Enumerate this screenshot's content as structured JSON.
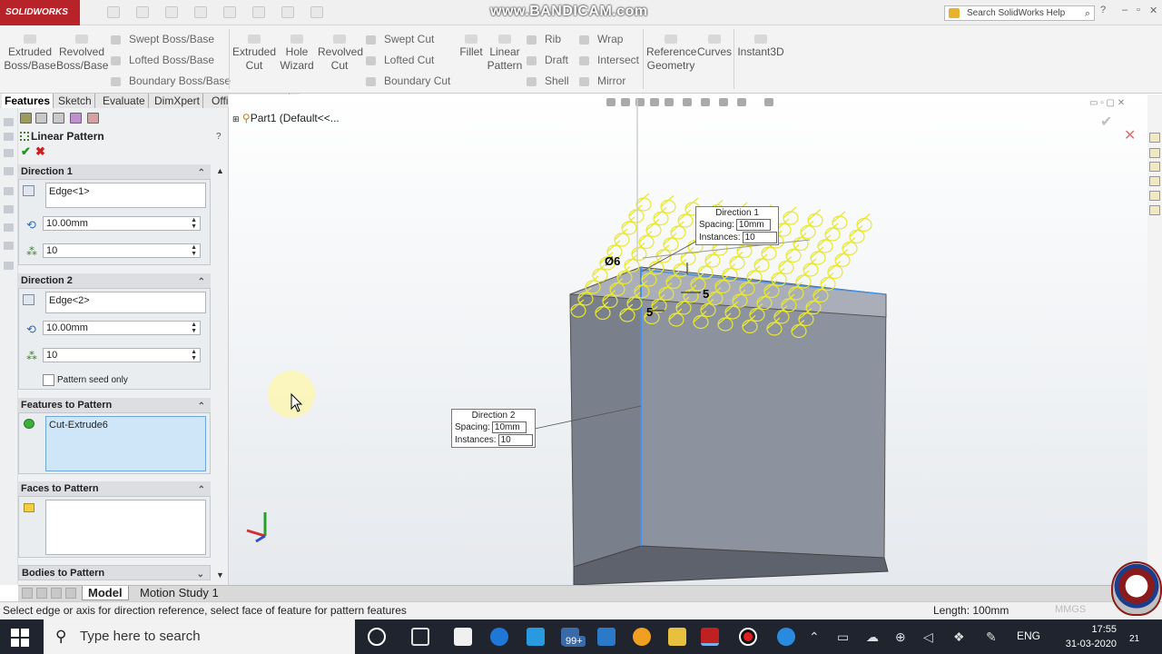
{
  "app": {
    "logo_text": "SOLIDWORKS",
    "watermark": "www.BANDICAM.com"
  },
  "help_search": {
    "placeholder": "Search SolidWorks Help"
  },
  "ribbon": {
    "extruded_boss": "Extruded Boss/Base",
    "revolved_boss": "Revolved Boss/Base",
    "swept_boss": "Swept Boss/Base",
    "lofted_boss": "Lofted Boss/Base",
    "boundary_boss": "Boundary Boss/Base",
    "extruded_cut": "Extruded Cut",
    "hole_wizard": "Hole Wizard",
    "revolved_cut": "Revolved Cut",
    "swept_cut": "Swept Cut",
    "lofted_cut": "Lofted Cut",
    "boundary_cut": "Boundary Cut",
    "fillet": "Fillet",
    "linear_pattern": "Linear Pattern",
    "rib": "Rib",
    "draft": "Draft",
    "shell": "Shell",
    "wrap": "Wrap",
    "intersect": "Intersect",
    "mirror": "Mirror",
    "reference_geometry": "Reference Geometry",
    "curves": "Curves",
    "instant3d": "Instant3D"
  },
  "tabs": [
    "Features",
    "Sketch",
    "Evaluate",
    "DimXpert",
    "Office Products"
  ],
  "property_manager": {
    "title": "Linear Pattern",
    "help": "?",
    "direction1": {
      "header": "Direction 1",
      "edge": "Edge<1>",
      "spacing": "10.00mm",
      "instances": "10"
    },
    "direction2": {
      "header": "Direction 2",
      "edge": "Edge<2>",
      "spacing": "10.00mm",
      "instances": "10",
      "seed_only_label": "Pattern seed only"
    },
    "features_to_pattern": {
      "header": "Features to Pattern",
      "item": "Cut-Extrude6"
    },
    "faces_to_pattern": {
      "header": "Faces to Pattern"
    },
    "bodies_to_pattern": {
      "header": "Bodies to Pattern"
    }
  },
  "tree": {
    "item": "Part1  (Default<<..."
  },
  "callouts": {
    "dir1": {
      "title": "Direction 1",
      "spacing_label": "Spacing:",
      "spacing": "10mm",
      "instances_label": "Instances:",
      "instances": "10"
    },
    "dir2": {
      "title": "Direction 2",
      "spacing_label": "Spacing:",
      "spacing": "10mm",
      "instances_label": "Instances:",
      "instances": "10"
    },
    "dim_diameter": "Ø6",
    "dim_5a": "5",
    "dim_5b": "5"
  },
  "bottom_tabs": [
    "Model",
    "Motion Study 1"
  ],
  "status": {
    "message": "Select edge or axis for direction reference, select face of feature for pattern features",
    "length": "Length: 100mm",
    "units": "MMGS"
  },
  "taskbar": {
    "search_placeholder": "Type here to search",
    "badge": "99+",
    "language": "ENG",
    "time": "17:55",
    "date": "31-03-2020",
    "notif_count": "21"
  },
  "colors": {
    "logo_red": "#b8232a",
    "pattern_yellow": "#f2f24a",
    "body_gray": "#8a8f9c",
    "edge_blue": "#4a90e2"
  }
}
